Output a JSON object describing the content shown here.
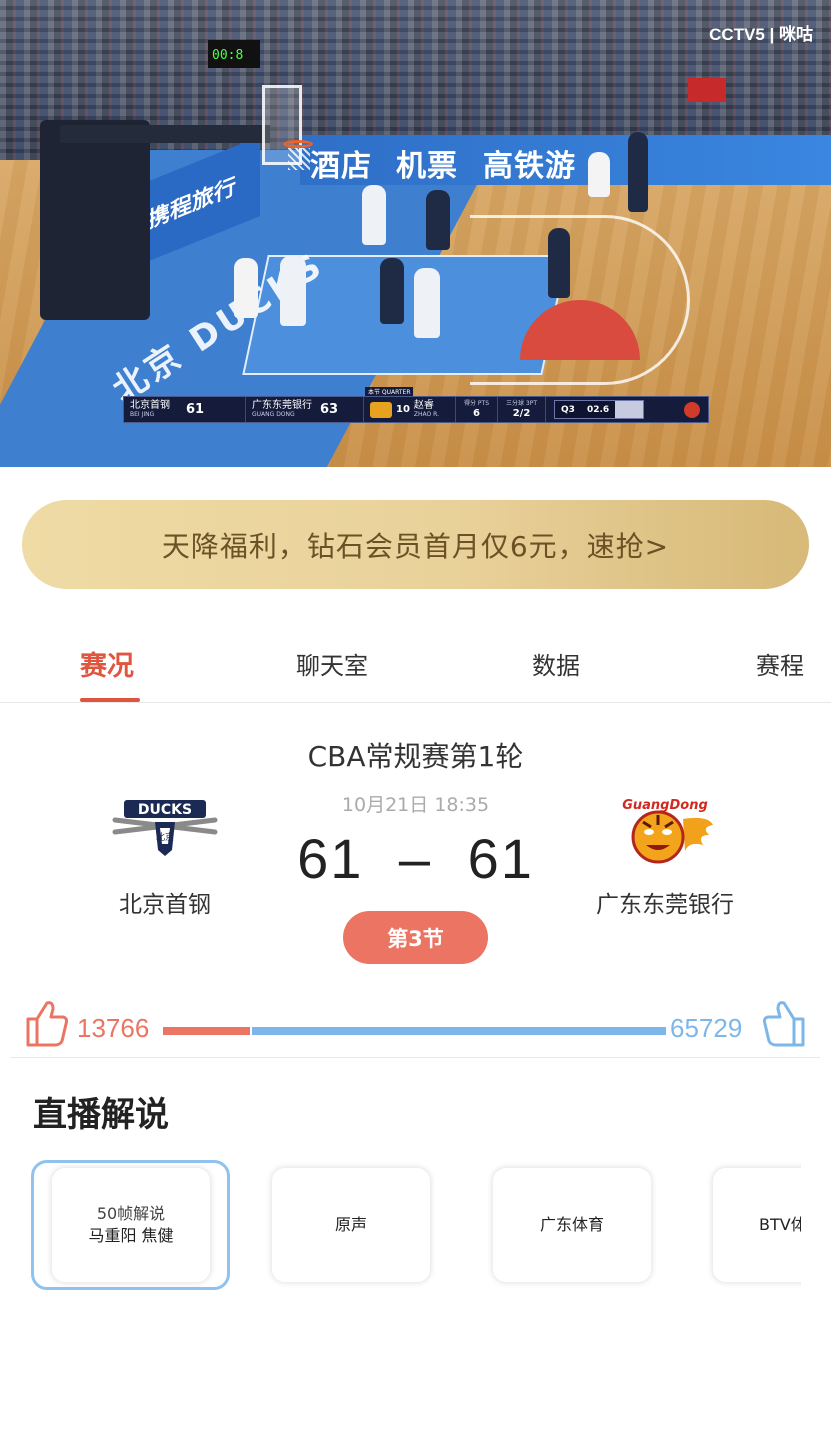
{
  "video": {
    "watermark": "CCTV5 | 咪咕",
    "banner_words": [
      "酒店",
      "机票",
      "高铁游"
    ],
    "side_board_text": "携程旅行",
    "floor_text": "北京 DUCKS",
    "shot_clock": "00:8",
    "scoreboard": {
      "quarter_tag": "本节 QUARTER",
      "home_cn": "北京首钢",
      "home_en": "BEI JING",
      "home_score": "61",
      "away_cn": "广东东莞银行",
      "away_en": "GUANG DONG",
      "away_score": "63",
      "player_number": "10",
      "player_cn": "赵睿",
      "player_en": "ZHAO R.",
      "pts_label": "得分 PTS",
      "pts_value": "6",
      "threept_label": "三分球 3PT",
      "threept_value": "2/2",
      "quarter": "Q3",
      "clock": "02.6"
    }
  },
  "promo": {
    "text": "天降福利，钻石会员首月仅6元，速抢>",
    "colors": {
      "start": "#efdba5",
      "end": "#d7b978",
      "text": "#6b5226"
    }
  },
  "tabs": [
    {
      "label": "赛况",
      "active": true
    },
    {
      "label": "聊天室",
      "active": false
    },
    {
      "label": "数据",
      "active": false
    },
    {
      "label": "赛程",
      "active": false
    }
  ],
  "match": {
    "title": "CBA常规赛第1轮",
    "datetime": "10月21日 18:35",
    "home_score": "61",
    "away_score": "61",
    "separator": "–",
    "period": "第3节",
    "home_team": "北京首钢",
    "away_team": "广东东莞银行",
    "home_logo_text": "DUCKS",
    "home_logo_sub": "北京",
    "away_logo_text": "GuangDong"
  },
  "support": {
    "home_likes": "13766",
    "away_likes": "65729",
    "home_share": 0.173,
    "colors": {
      "home": "#ec7462",
      "away": "#7db7ea"
    }
  },
  "commentary": {
    "title": "直播解说",
    "options": [
      {
        "line1": "50帧解说",
        "line2": "马重阳  焦健",
        "selected": true
      },
      {
        "line1": "原声",
        "line2": "",
        "selected": false
      },
      {
        "line1": "广东体育",
        "line2": "",
        "selected": false
      },
      {
        "line1": "BTV体",
        "line2": "",
        "selected": false
      }
    ]
  },
  "accent": "#e0553f"
}
